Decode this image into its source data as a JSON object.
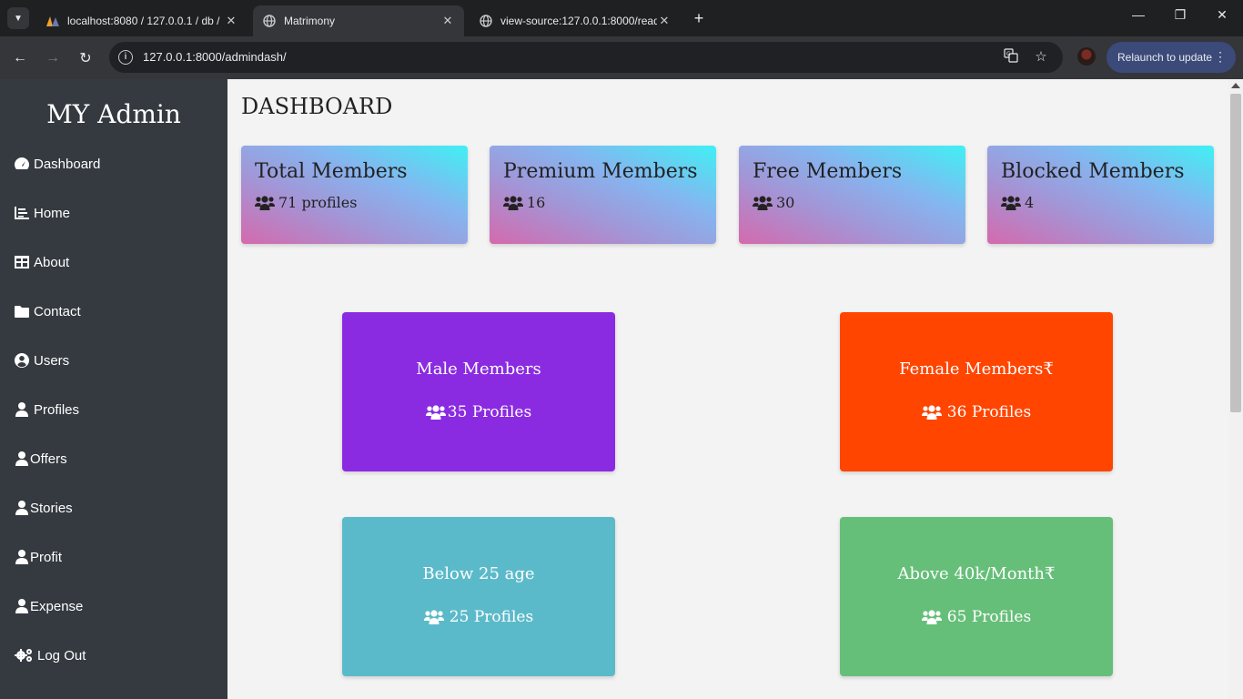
{
  "browser": {
    "tabs": [
      {
        "title": "localhost:8080 / 127.0.0.1 / db /",
        "favicon": "phpmyadmin-icon",
        "active": false
      },
      {
        "title": "Matrimony",
        "favicon": "globe-icon",
        "active": true
      },
      {
        "title": "view-source:127.0.0.1:8000/read",
        "favicon": "globe-icon",
        "active": false
      }
    ],
    "url": "127.0.0.1:8000/admindash/",
    "relaunch_label": "Relaunch to update"
  },
  "sidebar": {
    "brand": "MY Admin",
    "items": [
      {
        "label": "Dashboard",
        "icon": "tachometer-icon"
      },
      {
        "label": "Home",
        "icon": "chart-line-icon"
      },
      {
        "label": "About",
        "icon": "table-icon"
      },
      {
        "label": "Contact",
        "icon": "folder-icon"
      },
      {
        "label": "Users",
        "icon": "user-circle-icon"
      },
      {
        "label": "Profiles",
        "icon": "user-icon"
      },
      {
        "label": "Offers",
        "icon": "user-icon"
      },
      {
        "label": "Stories",
        "icon": "user-icon"
      },
      {
        "label": "Profit",
        "icon": "user-icon"
      },
      {
        "label": "Expense",
        "icon": "user-icon"
      },
      {
        "label": "Log Out",
        "icon": "cogs-icon"
      }
    ]
  },
  "main": {
    "title": "DASHBOARD",
    "stats": [
      {
        "title": "Total Members",
        "value": "71 profiles"
      },
      {
        "title": "Premium Members",
        "value": "16"
      },
      {
        "title": "Free Members",
        "value": "30"
      },
      {
        "title": "Blocked Members",
        "value": "4"
      }
    ],
    "cards": [
      {
        "title": "Male Members",
        "value": "35 Profiles",
        "color": "#8a2be2"
      },
      {
        "title": "Female Members₹",
        "value": "36 Profiles",
        "color": "#ff4500"
      },
      {
        "title": "Below 25 age",
        "value": "25 Profiles",
        "color": "#5bbac9"
      },
      {
        "title": "Above 40k/Month₹",
        "value": "65 Profiles",
        "color": "#66bf79"
      }
    ]
  }
}
